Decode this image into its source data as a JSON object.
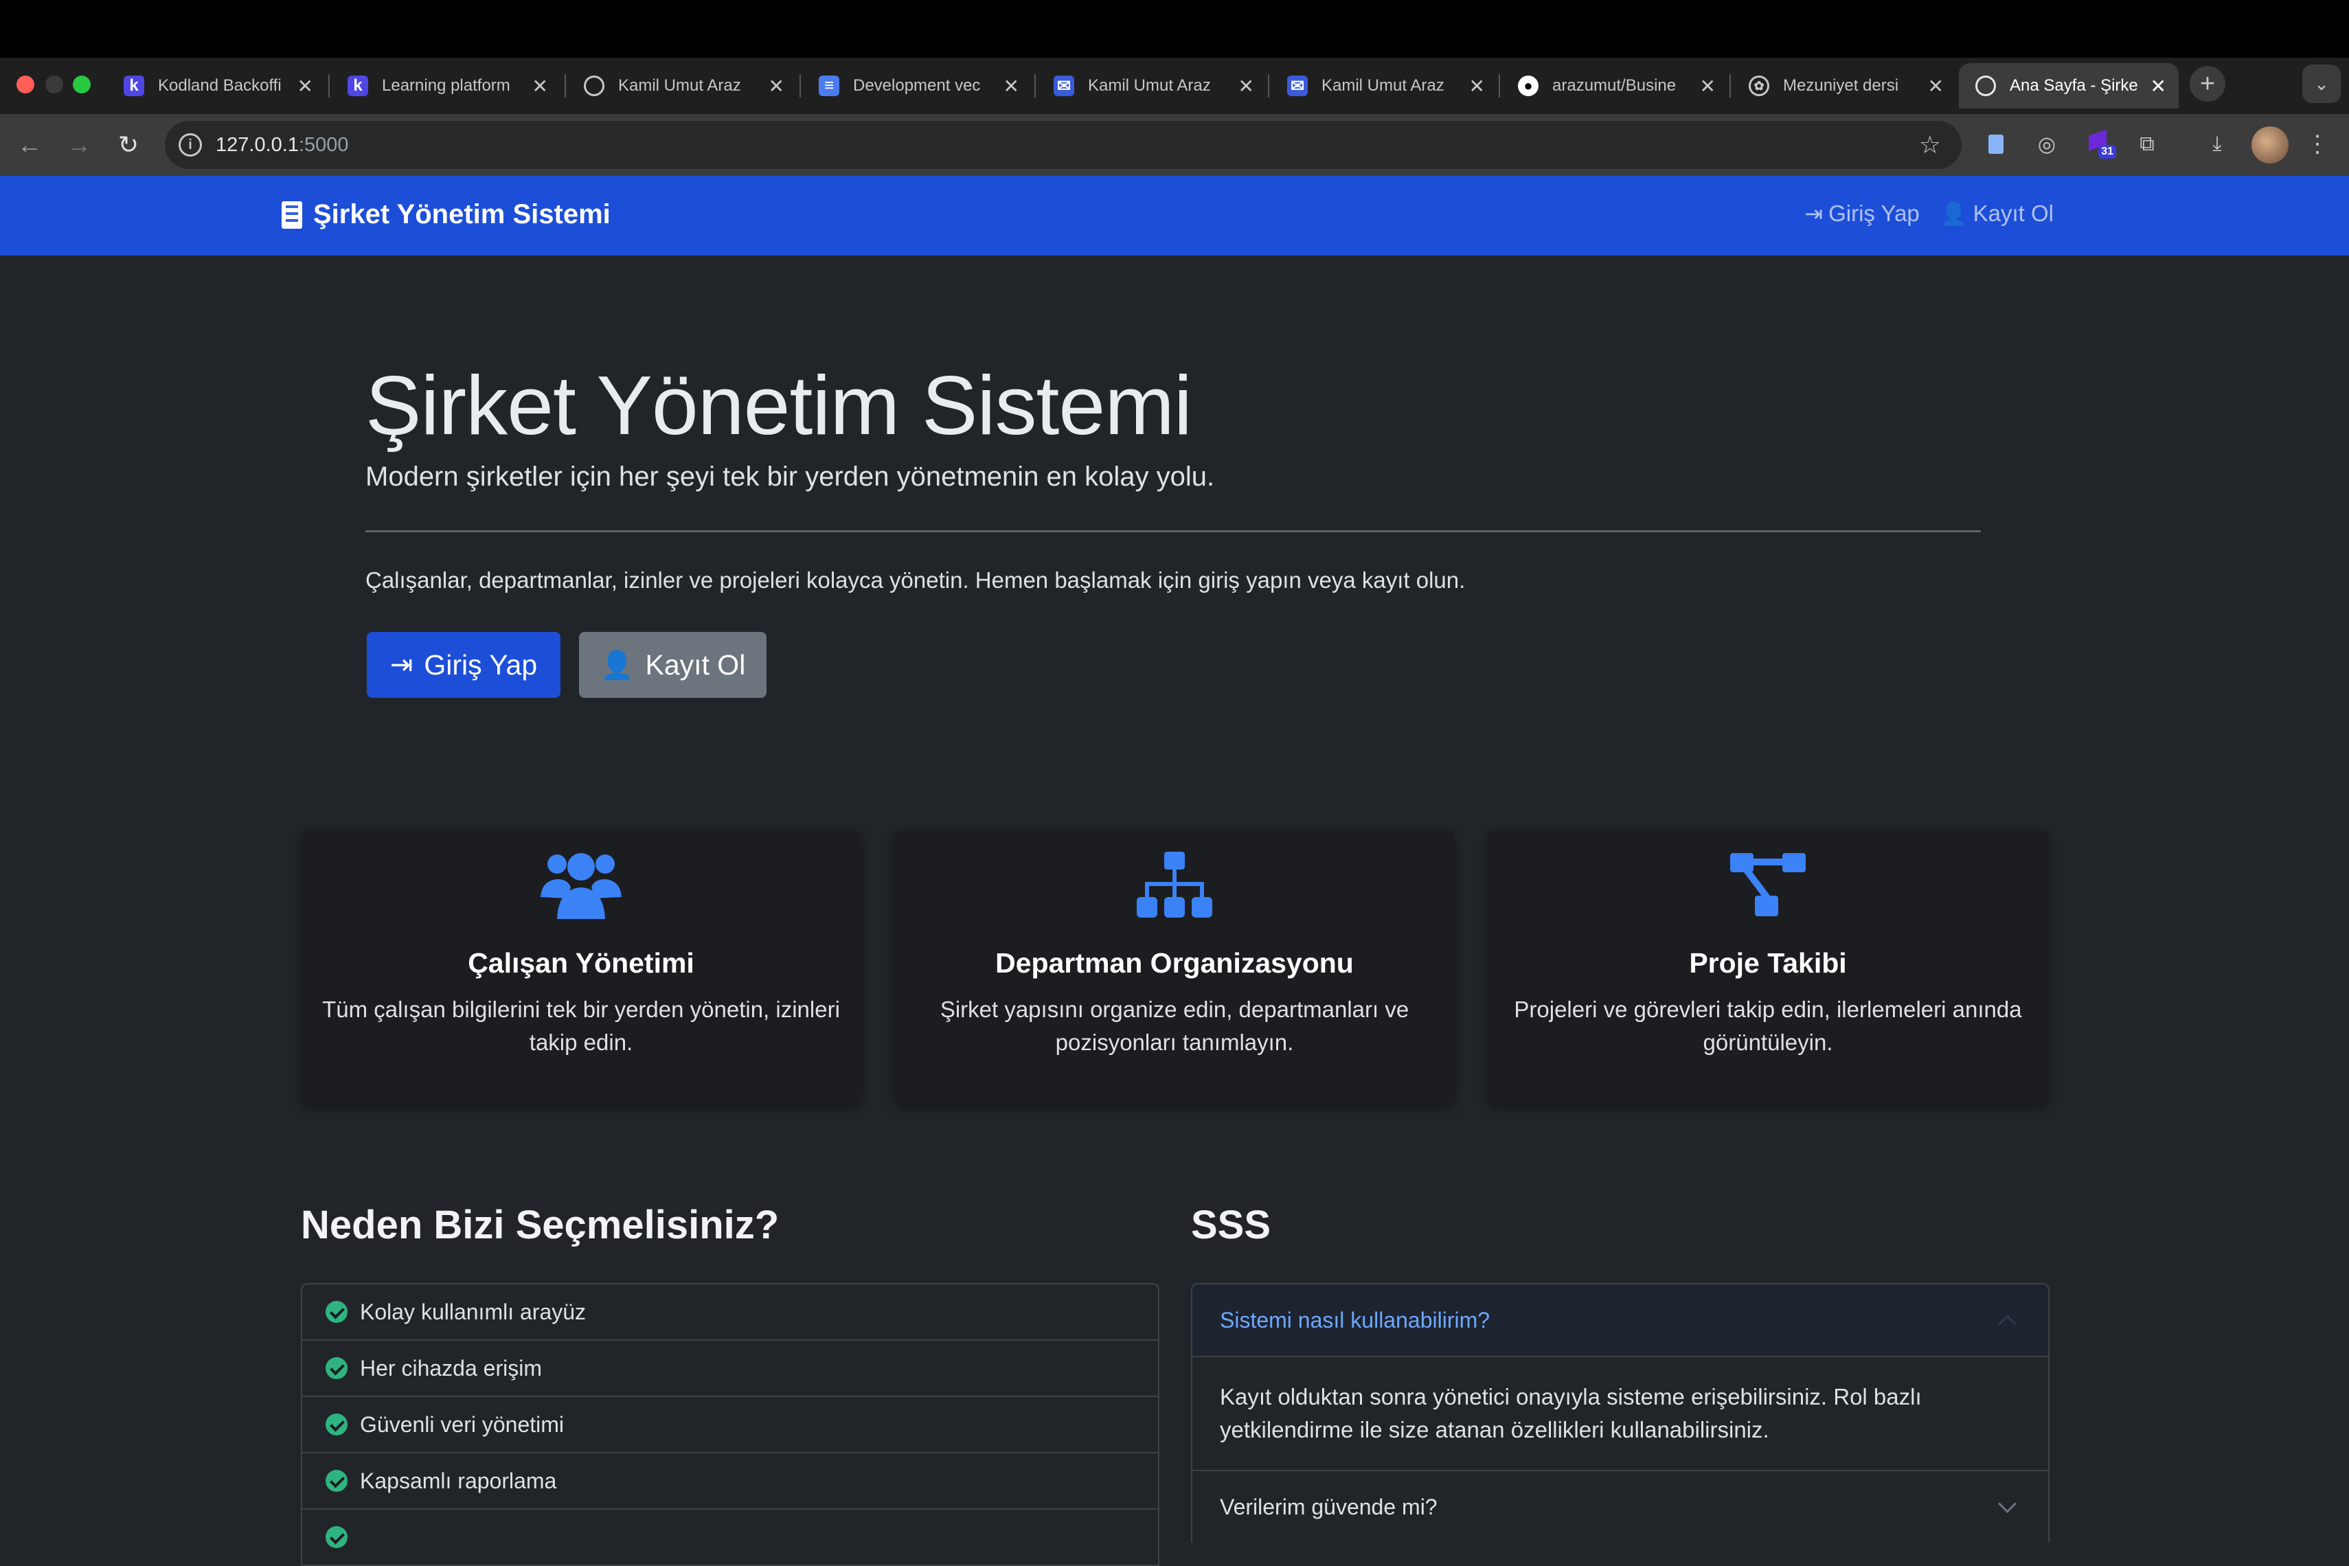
{
  "browser": {
    "tabs": [
      {
        "title": "Kodland Backoffi",
        "icon": "kodland-icon",
        "active": false
      },
      {
        "title": "Learning platform",
        "icon": "kodland-icon",
        "active": false
      },
      {
        "title": "Kamil Umut Araz",
        "icon": "globe-icon",
        "active": false
      },
      {
        "title": "Development vec",
        "icon": "forms-icon",
        "active": false
      },
      {
        "title": "Kamil Umut Araz",
        "icon": "mail-icon",
        "active": false
      },
      {
        "title": "Kamil Umut Araz",
        "icon": "mail-icon",
        "active": false
      },
      {
        "title": "arazumut/Busine",
        "icon": "github-icon",
        "active": false
      },
      {
        "title": "Mezuniyet dersi",
        "icon": "openai-icon",
        "active": false
      },
      {
        "title": "Ana Sayfa - Şirke",
        "icon": "globe-icon",
        "active": true
      }
    ],
    "address": {
      "host": "127.0.0.1",
      "port": ":5000"
    },
    "extension_badge": "31"
  },
  "navbar": {
    "brand": "Şirket Yönetim Sistemi",
    "login": "Giriş Yap",
    "register": "Kayıt Ol"
  },
  "hero": {
    "title": "Şirket Yönetim Sistemi",
    "subtitle": "Modern şirketler için her şeyi tek bir yerden yönetmenin en kolay yolu.",
    "text": "Çalışanlar, departmanlar, izinler ve projeleri kolayca yönetin. Hemen başlamak için giriş yapın veya kayıt olun.",
    "login_button": "Giriş Yap",
    "register_button": "Kayıt Ol"
  },
  "features": [
    {
      "icon": "users-icon",
      "title": "Çalışan Yönetimi",
      "text": "Tüm çalışan bilgilerini tek bir yerden yönetin, izinleri takip edin."
    },
    {
      "icon": "sitemap-icon",
      "title": "Departman Organizasyonu",
      "text": "Şirket yapısını organize edin, departmanları ve pozisyonları tanımlayın."
    },
    {
      "icon": "project-diagram-icon",
      "title": "Proje Takibi",
      "text": "Projeleri ve görevleri takip edin, ilerlemeleri anında görüntüleyin."
    }
  ],
  "why": {
    "title": "Neden Bizi Seçmelisiniz?",
    "items": [
      "Kolay kullanımlı arayüz",
      "Her cihazda erişim",
      "Güvenli veri yönetimi",
      "Kapsamlı raporlama"
    ]
  },
  "faq": {
    "title": "SSS",
    "items": [
      {
        "question": "Sistemi nasıl kullanabilirim?",
        "answer": "Kayıt olduktan sonra yönetici onayıyla sisteme erişebilirsiniz. Rol bazlı yetkilendirme ile size atanan özellikleri kullanabilirsiniz.",
        "open": true
      },
      {
        "question": "Verilerim güvende mi?",
        "open": false
      }
    ]
  },
  "colors": {
    "primary": "#1d4ed8",
    "secondary": "#6c757d",
    "background": "#212529",
    "accent_icon": "#3b82f6",
    "check": "#2fb380"
  }
}
